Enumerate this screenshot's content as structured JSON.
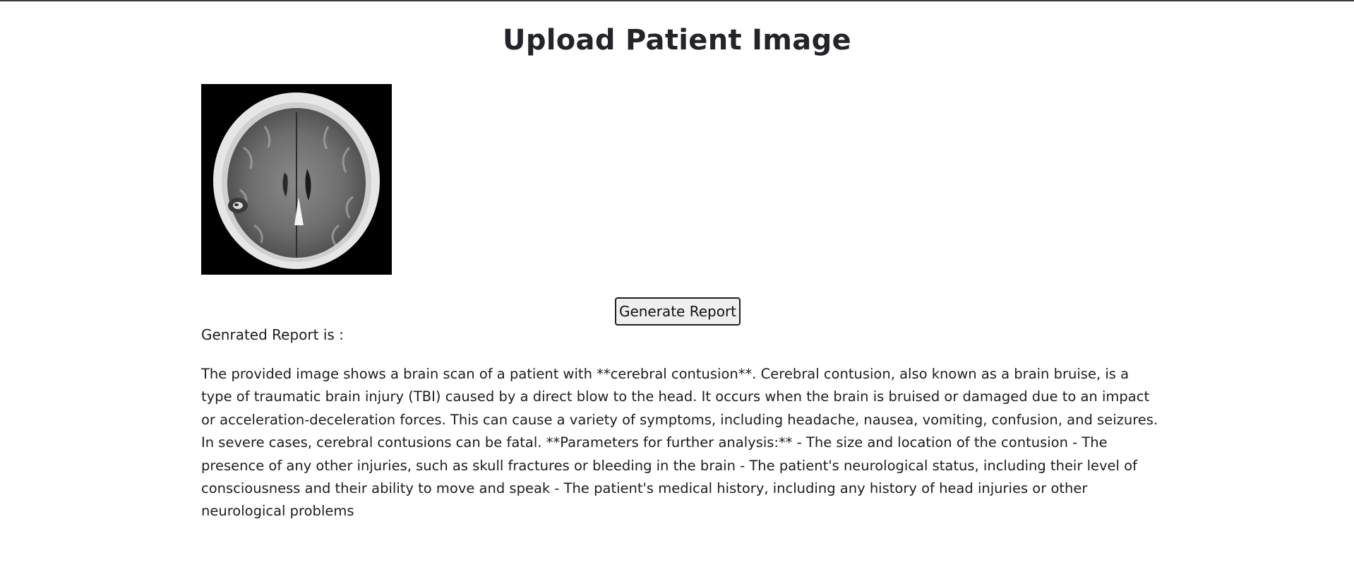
{
  "page": {
    "title": "Upload Patient Image"
  },
  "upload": {
    "image_icon": "brain-ct-scan-image"
  },
  "actions": {
    "generate_label": "Generate Report"
  },
  "report": {
    "label": "Genrated Report is :",
    "text": "The provided image shows a brain scan of a patient with **cerebral contusion**. Cerebral contusion, also known as a brain bruise, is a type of traumatic brain injury (TBI) caused by a direct blow to the head. It occurs when the brain is bruised or damaged due to an impact or acceleration-deceleration forces. This can cause a variety of symptoms, including headache, nausea, vomiting, confusion, and seizures. In severe cases, cerebral contusions can be fatal. **Parameters for further analysis:** - The size and location of the contusion - The presence of any other injuries, such as skull fractures or bleeding in the brain - The patient's neurological status, including their level of consciousness and their ability to move and speak - The patient's medical history, including any history of head injuries or other neurological problems"
  }
}
